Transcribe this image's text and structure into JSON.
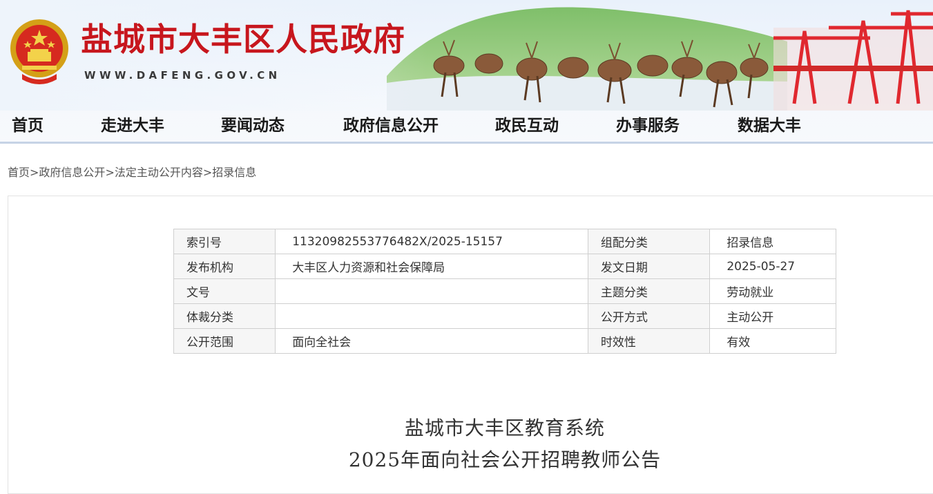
{
  "site": {
    "title": "盐城市大丰区人民政府",
    "domain": "WWW.DAFENG.GOV.CN"
  },
  "nav": [
    {
      "label": "首页"
    },
    {
      "label": "走进大丰"
    },
    {
      "label": "要闻动态"
    },
    {
      "label": "政府信息公开"
    },
    {
      "label": "政民互动"
    },
    {
      "label": "办事服务"
    },
    {
      "label": "数据大丰"
    }
  ],
  "breadcrumb": [
    "首页",
    "政府信息公开",
    "法定主动公开内容",
    "招录信息"
  ],
  "breadcrumb_sep": ">",
  "meta_table": [
    {
      "k1": "索引号",
      "v1": "11320982553776482X/2025-15157",
      "k2": "组配分类",
      "v2": "招录信息"
    },
    {
      "k1": "发布机构",
      "v1": "大丰区人力资源和社会保障局",
      "k2": "发文日期",
      "v2": "2025-05-27"
    },
    {
      "k1": "文号",
      "v1": "",
      "k2": "主题分类",
      "v2": "劳动就业"
    },
    {
      "k1": "体裁分类",
      "v1": "",
      "k2": "公开方式",
      "v2": "主动公开"
    },
    {
      "k1": "公开范围",
      "v1": "面向全社会",
      "k2": "时效性",
      "v2": "有效"
    }
  ],
  "document": {
    "title_line1": "盐城市大丰区教育系统",
    "title_line2": "2025年面向社会公开招聘教师公告"
  },
  "colors": {
    "brand_red": "#c7161d",
    "nav_rule": "#c6d3e6"
  }
}
